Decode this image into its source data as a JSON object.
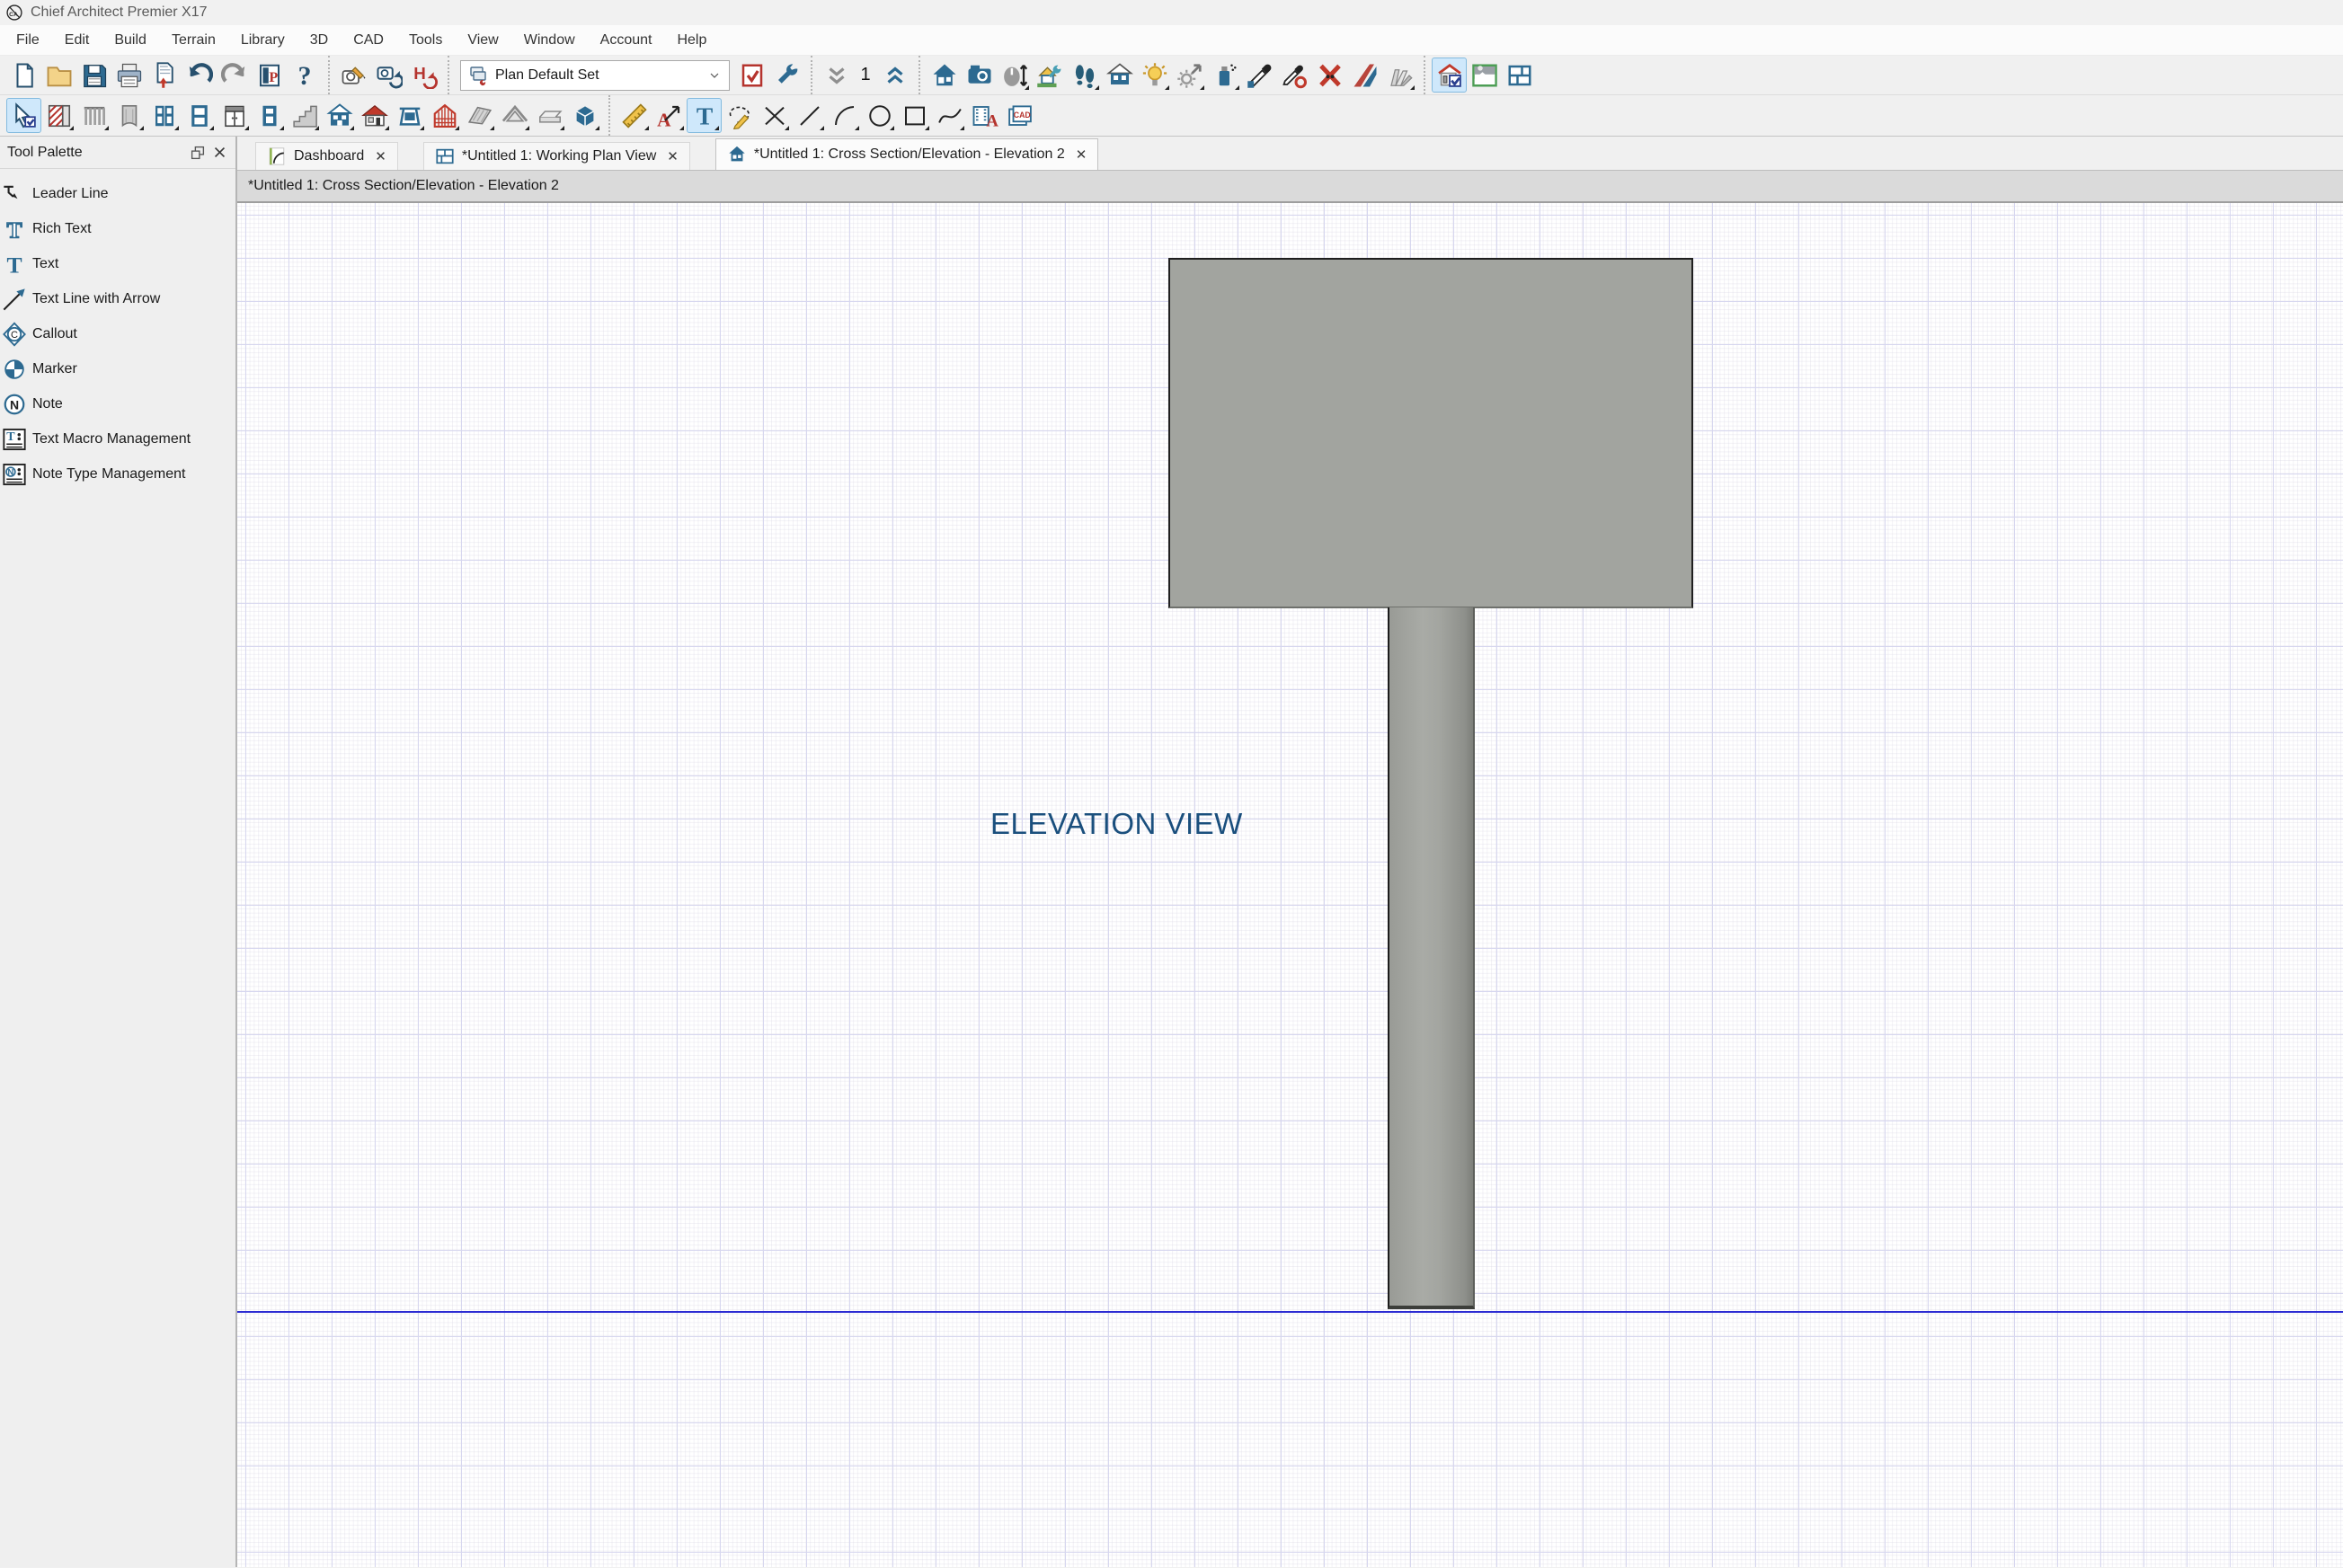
{
  "app": {
    "title": "Chief Architect Premier X17",
    "logo_icon": "app-logo"
  },
  "menu": {
    "items": [
      "File",
      "Edit",
      "Build",
      "Terrain",
      "Library",
      "3D",
      "CAD",
      "Tools",
      "View",
      "Window",
      "Account",
      "Help"
    ]
  },
  "toolbars": {
    "main_groups": [
      {
        "name": "file-group",
        "items": [
          {
            "name": "new-plan",
            "icon": "doc"
          },
          {
            "name": "open-plan",
            "icon": "folder"
          },
          {
            "name": "save-plan",
            "icon": "floppy"
          },
          {
            "name": "print",
            "icon": "printer"
          },
          {
            "name": "export-view",
            "icon": "page-up"
          },
          {
            "name": "undo",
            "icon": "undo"
          },
          {
            "name": "redo",
            "icon": "redo"
          },
          {
            "name": "project-browser",
            "icon": "p-panel"
          },
          {
            "name": "help",
            "icon": "question"
          }
        ]
      },
      {
        "name": "view-refresh-group",
        "items": [
          {
            "name": "edit-active-view",
            "icon": "camera-pencil"
          },
          {
            "name": "refresh-camera-view",
            "icon": "camera-refresh"
          },
          {
            "name": "rebuild-3d",
            "icon": "h-refresh"
          }
        ]
      },
      {
        "name": "defaults-group",
        "items": [
          {
            "type": "dropdown",
            "name": "default-set",
            "icon": "layers-wrench",
            "value": "Plan Default Set"
          },
          {
            "name": "active-defaults",
            "icon": "checklist"
          },
          {
            "name": "default-settings",
            "icon": "wrench"
          }
        ]
      },
      {
        "name": "floor-group",
        "items": [
          {
            "name": "down-one-floor",
            "icon": "chevrons-down"
          },
          {
            "type": "text",
            "name": "current-floor",
            "value": "1"
          },
          {
            "name": "up-one-floor",
            "icon": "chevrons-up"
          }
        ]
      },
      {
        "name": "camera-group",
        "items": [
          {
            "name": "full-camera",
            "icon": "house-blue"
          },
          {
            "name": "perspective-camera",
            "icon": "camera-blue"
          },
          {
            "name": "mouse-orbit-camera",
            "icon": "mouse-arrows",
            "flyout": true
          },
          {
            "name": "remodel-3d",
            "icon": "house-wrench"
          },
          {
            "name": "walkthrough",
            "icon": "footprints",
            "flyout": true
          },
          {
            "name": "doll-house-view",
            "icon": "dollhouse"
          },
          {
            "name": "toggle-sunlight",
            "icon": "bulb",
            "flyout": true
          },
          {
            "name": "adjust-lights",
            "icon": "sun-arrow",
            "flyout": true
          },
          {
            "name": "spray-material",
            "icon": "spray",
            "flyout": true
          },
          {
            "name": "color-eyedropper",
            "icon": "eyedropper"
          },
          {
            "name": "object-eyedropper",
            "icon": "eyedropper-o"
          },
          {
            "name": "delete-3d-surface",
            "icon": "x-red"
          },
          {
            "name": "material-blade",
            "icon": "stripes"
          },
          {
            "name": "fan-deck",
            "icon": "fan-deck",
            "flyout": true
          }
        ]
      },
      {
        "name": "view-tools-group",
        "items": [
          {
            "name": "cross-section-elevation",
            "icon": "house-check",
            "active": true
          },
          {
            "name": "picture-backdrop",
            "icon": "picture"
          },
          {
            "name": "tile-windows",
            "icon": "tiles"
          }
        ]
      }
    ],
    "build_groups": [
      {
        "name": "build-group",
        "items": [
          {
            "name": "select-objects",
            "icon": "cursor-check",
            "active": true
          },
          {
            "name": "straight-wall",
            "icon": "wall",
            "flyout": true
          },
          {
            "name": "straight-railing",
            "icon": "railing",
            "flyout": true
          },
          {
            "name": "curved-wall",
            "icon": "arch",
            "flyout": true
          },
          {
            "name": "hinged-door",
            "icon": "door",
            "flyout": true
          },
          {
            "name": "window",
            "icon": "window",
            "flyout": true
          },
          {
            "name": "base-cabinet",
            "icon": "cabinet",
            "flyout": true
          },
          {
            "name": "doorway",
            "icon": "door2",
            "flyout": true
          },
          {
            "name": "straight-stairs",
            "icon": "stairs",
            "flyout": true
          },
          {
            "name": "auto-dormer",
            "icon": "house-windows",
            "flyout": true
          },
          {
            "name": "auto-roof",
            "icon": "house-red-roof",
            "flyout": true
          },
          {
            "name": "bay-window",
            "icon": "bay-window",
            "flyout": true
          },
          {
            "name": "build-framing",
            "icon": "framing-house",
            "flyout": true
          },
          {
            "name": "roof-plane",
            "icon": "roof-plane",
            "flyout": true
          },
          {
            "name": "gable-roof",
            "icon": "gable",
            "flyout": true
          },
          {
            "name": "soffit",
            "icon": "soffit",
            "flyout": true
          },
          {
            "name": "primitive-box",
            "icon": "box3d",
            "flyout": true
          }
        ]
      },
      {
        "name": "cad-text-group",
        "items": [
          {
            "name": "dimension",
            "icon": "ruler",
            "flyout": true
          },
          {
            "name": "text-with-arrow",
            "icon": "text-arrow",
            "flyout": true
          },
          {
            "name": "text",
            "icon": "text-T",
            "active": true,
            "flyout": true
          },
          {
            "name": "sketch-mask",
            "icon": "sketch"
          },
          {
            "name": "cross-box",
            "icon": "cross",
            "flyout": true
          },
          {
            "name": "draw-line",
            "icon": "line",
            "flyout": true
          },
          {
            "name": "draw-arc",
            "icon": "arc",
            "flyout": true
          },
          {
            "name": "draw-circle",
            "icon": "circle",
            "flyout": true
          },
          {
            "name": "draw-rectangle",
            "icon": "rect",
            "flyout": true
          },
          {
            "name": "draw-spline",
            "icon": "spline",
            "flyout": true
          },
          {
            "name": "cad-text-tools",
            "icon": "film-text"
          },
          {
            "name": "cad-detail",
            "icon": "cad-box"
          }
        ]
      }
    ]
  },
  "tool_palette": {
    "title": "Tool Palette",
    "header_icons": [
      "float-icon",
      "close-icon"
    ],
    "items": [
      {
        "label": "Leader Line",
        "icon": "leader-line"
      },
      {
        "label": "Rich Text",
        "icon": "rich-text"
      },
      {
        "label": "Text",
        "icon": "text-plain"
      },
      {
        "label": "Text Line with Arrow",
        "icon": "text-line-arrow"
      },
      {
        "label": "Callout",
        "icon": "callout"
      },
      {
        "label": "Marker",
        "icon": "marker"
      },
      {
        "label": "Note",
        "icon": "note"
      },
      {
        "label": "Text Macro Management",
        "icon": "text-macro"
      },
      {
        "label": "Note Type Management",
        "icon": "note-type"
      }
    ]
  },
  "tabs": [
    {
      "label": "Dashboard",
      "icon": "dashboard-page",
      "active": false
    },
    {
      "label": "*Untitled 1:  Working Plan View",
      "icon": "plan-view",
      "active": false
    },
    {
      "label": "*Untitled 1: Cross Section/Elevation - Elevation 2",
      "icon": "elevation-house",
      "active": true
    }
  ],
  "view_label": "*Untitled 1: Cross Section/Elevation - Elevation 2",
  "canvas": {
    "annotation": "ELEVATION VIEW",
    "shapes": [
      "sign-board",
      "sign-post",
      "ground-line"
    ],
    "colors": {
      "grid_major": "#d7d7ef",
      "grid_minor": "#eceaf2",
      "ground_line": "#2b2bd2",
      "shape_fill": "#a2a49f",
      "annotation_text": "#1a4f7d",
      "selection_highlight": "#cfe8fb"
    }
  }
}
